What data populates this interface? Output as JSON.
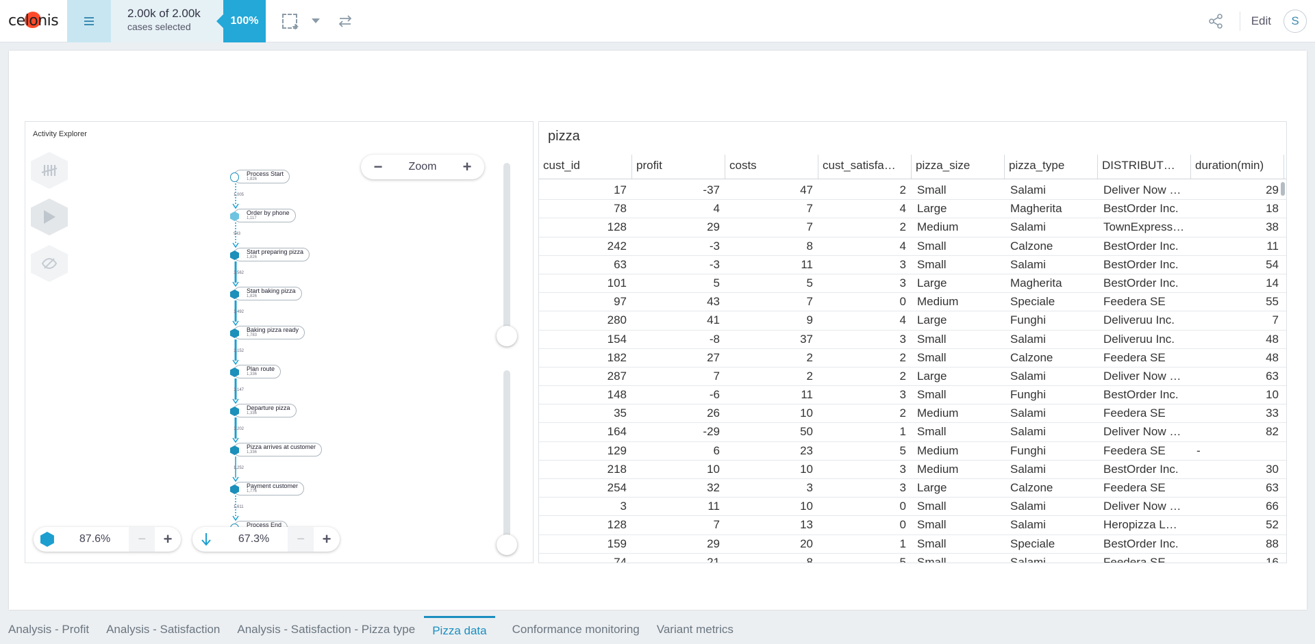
{
  "app": {
    "logo_text": "celonis"
  },
  "topbar": {
    "cases_count": "2.00k of 2.00k",
    "cases_label": "cases selected",
    "percent": "100%",
    "edit_label": "Edit",
    "avatar_initial": "S"
  },
  "activity_explorer": {
    "title": "Activity Explorer",
    "zoom_label": "Zoom",
    "zoom_minus": "−",
    "zoom_plus": "+",
    "activity_pct": "87.6%",
    "connection_pct": "67.3%",
    "nodes": [
      {
        "label": "Process Start",
        "count": "1,826"
      },
      {
        "label": "Order by phone",
        "count": "1,117"
      },
      {
        "label": "Start preparing pizza",
        "count": "1,826"
      },
      {
        "label": "Start baking pizza",
        "count": "1,826"
      },
      {
        "label": "Baking pizza ready",
        "count": "1,783"
      },
      {
        "label": "Plan route",
        "count": "1,336"
      },
      {
        "label": "Departure pizza",
        "count": "1,336"
      },
      {
        "label": "Pizza arrives at customer",
        "count": "1,336"
      },
      {
        "label": "Payment customer",
        "count": "1,776"
      },
      {
        "label": "Process End",
        "count": ""
      }
    ],
    "edges": [
      "1,005",
      "943",
      "1,562",
      "1,492",
      "1,152",
      "1,147",
      "1,202",
      "1,252",
      "1,611"
    ]
  },
  "table": {
    "title": "pizza",
    "columns": [
      "cust_id",
      "profit",
      "costs",
      "cust_satisfa…",
      "pizza_size",
      "pizza_type",
      "DISTRIBUT…",
      "duration(min)"
    ],
    "rows": [
      [
        "17",
        "-37",
        "47",
        "2",
        "Small",
        "Salami",
        "Deliver Now …",
        "29"
      ],
      [
        "78",
        "4",
        "7",
        "4",
        "Large",
        "Magherita",
        "BestOrder Inc.",
        "18"
      ],
      [
        "128",
        "29",
        "7",
        "2",
        "Medium",
        "Salami",
        "TownExpress…",
        "38"
      ],
      [
        "242",
        "-3",
        "8",
        "4",
        "Small",
        "Calzone",
        "BestOrder Inc.",
        "11"
      ],
      [
        "63",
        "-3",
        "11",
        "3",
        "Small",
        "Salami",
        "BestOrder Inc.",
        "54"
      ],
      [
        "101",
        "5",
        "5",
        "3",
        "Large",
        "Magherita",
        "BestOrder Inc.",
        "14"
      ],
      [
        "97",
        "43",
        "7",
        "0",
        "Medium",
        "Speciale",
        "Feedera SE",
        "55"
      ],
      [
        "280",
        "41",
        "9",
        "4",
        "Large",
        "Funghi",
        "Deliveruu Inc.",
        "7"
      ],
      [
        "154",
        "-8",
        "37",
        "3",
        "Small",
        "Salami",
        "Deliveruu Inc.",
        "48"
      ],
      [
        "182",
        "27",
        "2",
        "2",
        "Small",
        "Calzone",
        "Feedera SE",
        "48"
      ],
      [
        "287",
        "7",
        "2",
        "2",
        "Large",
        "Salami",
        "Deliver Now …",
        "63"
      ],
      [
        "148",
        "-6",
        "11",
        "3",
        "Small",
        "Funghi",
        "BestOrder Inc.",
        "10"
      ],
      [
        "35",
        "26",
        "10",
        "2",
        "Medium",
        "Salami",
        "Feedera SE",
        "33"
      ],
      [
        "164",
        "-29",
        "50",
        "1",
        "Small",
        "Salami",
        "Deliver Now …",
        "82"
      ],
      [
        "129",
        "6",
        "23",
        "5",
        "Medium",
        "Funghi",
        "Feedera SE",
        "-"
      ],
      [
        "218",
        "10",
        "10",
        "3",
        "Medium",
        "Salami",
        "BestOrder Inc.",
        "30"
      ],
      [
        "254",
        "32",
        "3",
        "3",
        "Large",
        "Calzone",
        "Feedera SE",
        "63"
      ],
      [
        "3",
        "11",
        "10",
        "0",
        "Small",
        "Salami",
        "Deliver Now …",
        "66"
      ],
      [
        "128",
        "7",
        "13",
        "0",
        "Small",
        "Salami",
        "Heropizza L…",
        "52"
      ],
      [
        "159",
        "29",
        "20",
        "1",
        "Small",
        "Speciale",
        "BestOrder Inc.",
        "88"
      ],
      [
        "74",
        "21",
        "8",
        "5",
        "Small",
        "Salami",
        "Feedera SE",
        "16"
      ]
    ]
  },
  "tabs": [
    {
      "label": "Analysis - Profit",
      "active": false
    },
    {
      "label": "Analysis - Satisfaction",
      "active": false
    },
    {
      "label": "Analysis - Satisfaction - Pizza type",
      "active": false
    },
    {
      "label": "Pizza data",
      "active": true
    },
    {
      "label": "Conformance monitoring",
      "active": false
    },
    {
      "label": "Variant metrics",
      "active": false
    }
  ],
  "colors": {
    "accent": "#1b8fc0",
    "highlight": "#23a8d8",
    "logo": "#ff4b2b"
  }
}
